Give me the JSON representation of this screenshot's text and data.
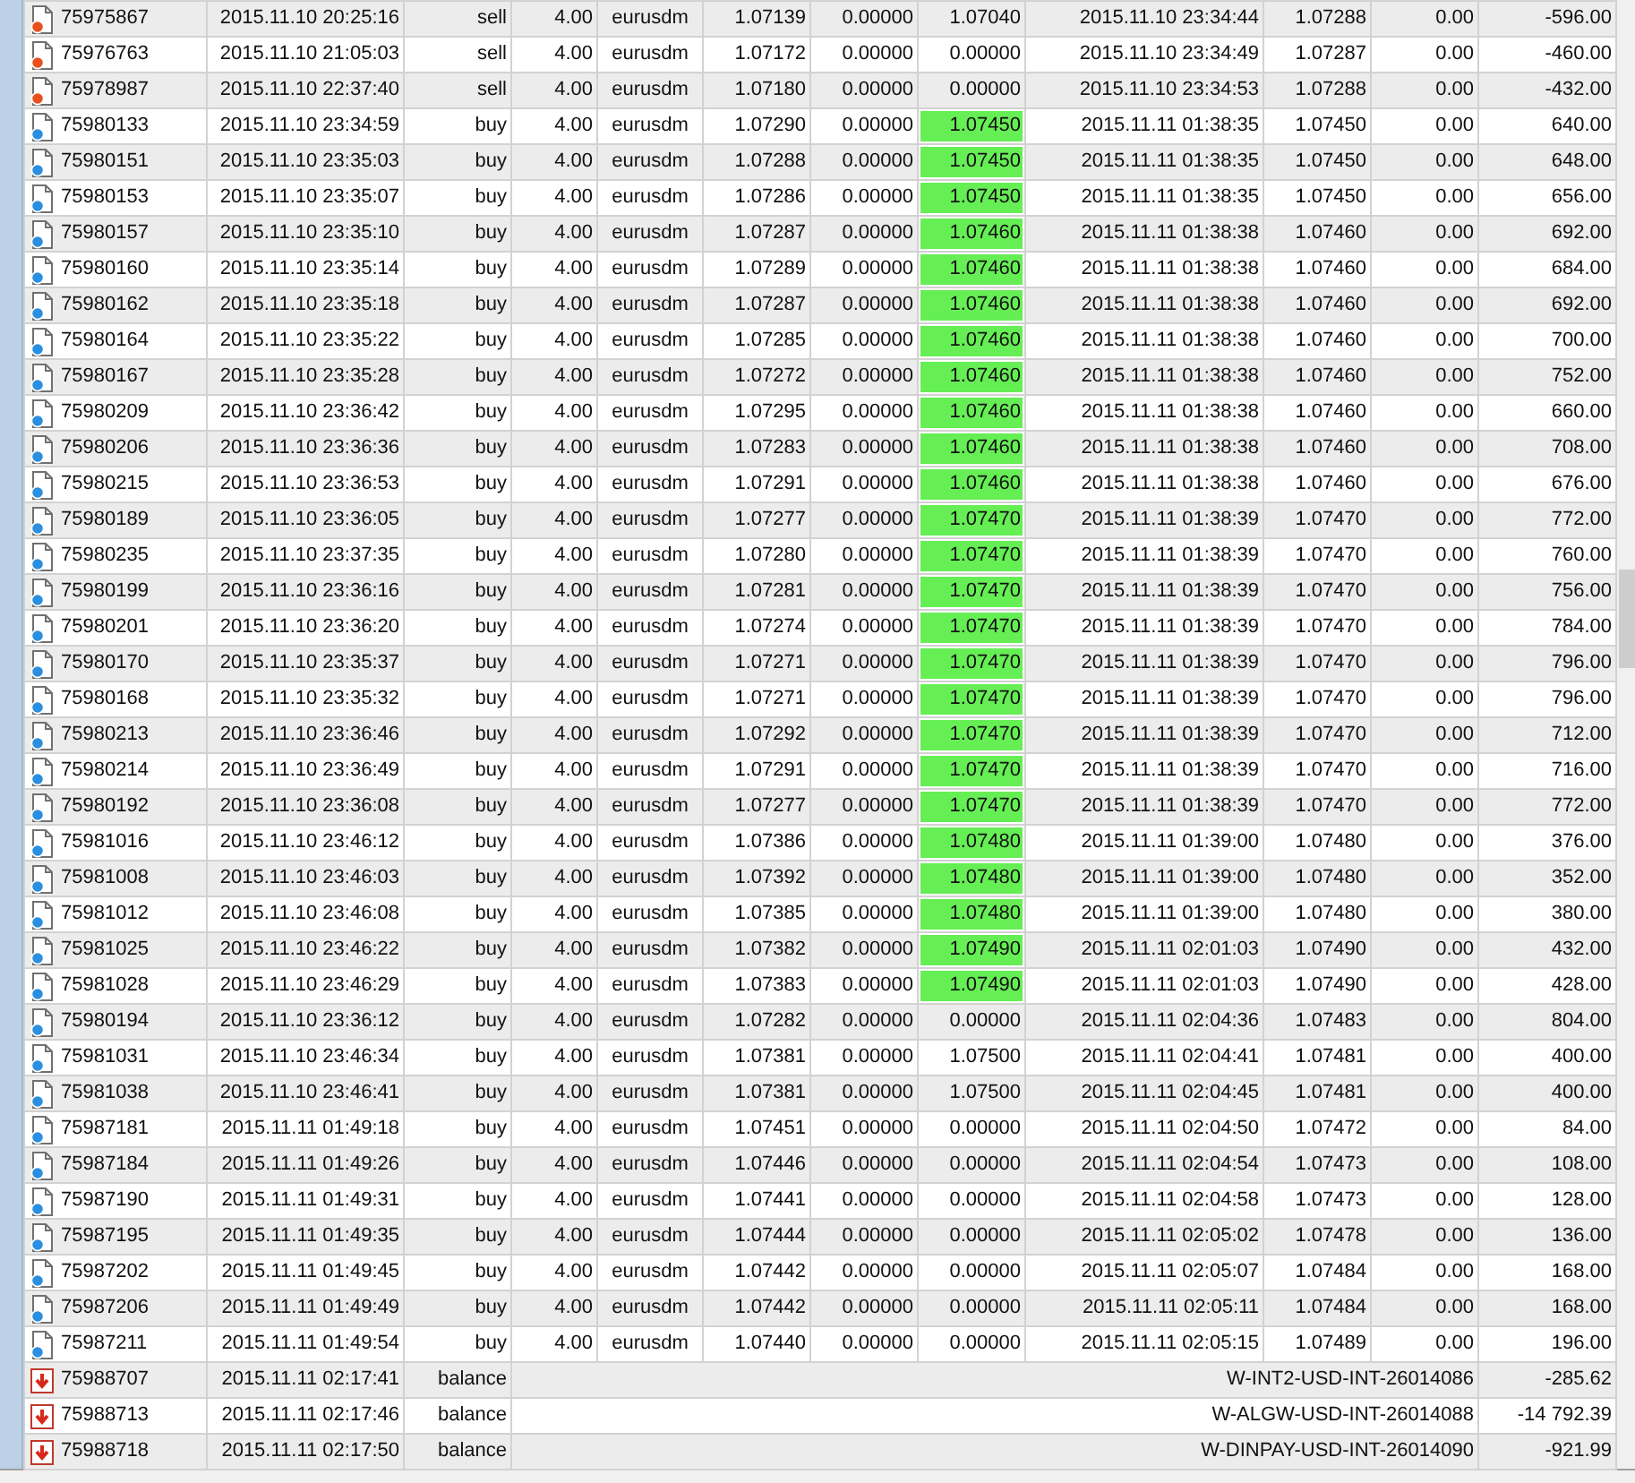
{
  "history": {
    "rows": [
      {
        "kind": "sell",
        "ticket": "75975867",
        "time": "2015.11.10 20:25:16",
        "type": "sell",
        "size": "4.00",
        "symbol": "eurusdm",
        "price": "1.07139",
        "sl": "0.00000",
        "tp": "1.07040",
        "tp_highlighted": false,
        "close_time": "2015.11.10 23:34:44",
        "close_price": "1.07288",
        "column_11": "0.00",
        "profit": "-596.00"
      },
      {
        "kind": "sell",
        "ticket": "75976763",
        "time": "2015.11.10 21:05:03",
        "type": "sell",
        "size": "4.00",
        "symbol": "eurusdm",
        "price": "1.07172",
        "sl": "0.00000",
        "tp": "0.00000",
        "tp_highlighted": false,
        "close_time": "2015.11.10 23:34:49",
        "close_price": "1.07287",
        "column_11": "0.00",
        "profit": "-460.00"
      },
      {
        "kind": "sell",
        "ticket": "75978987",
        "time": "2015.11.10 22:37:40",
        "type": "sell",
        "size": "4.00",
        "symbol": "eurusdm",
        "price": "1.07180",
        "sl": "0.00000",
        "tp": "0.00000",
        "tp_highlighted": false,
        "close_time": "2015.11.10 23:34:53",
        "close_price": "1.07288",
        "column_11": "0.00",
        "profit": "-432.00"
      },
      {
        "kind": "buy",
        "ticket": "75980133",
        "time": "2015.11.10 23:34:59",
        "type": "buy",
        "size": "4.00",
        "symbol": "eurusdm",
        "price": "1.07290",
        "sl": "0.00000",
        "tp": "1.07450",
        "tp_highlighted": true,
        "close_time": "2015.11.11 01:38:35",
        "close_price": "1.07450",
        "column_11": "0.00",
        "profit": "640.00"
      },
      {
        "kind": "buy",
        "ticket": "75980151",
        "time": "2015.11.10 23:35:03",
        "type": "buy",
        "size": "4.00",
        "symbol": "eurusdm",
        "price": "1.07288",
        "sl": "0.00000",
        "tp": "1.07450",
        "tp_highlighted": true,
        "close_time": "2015.11.11 01:38:35",
        "close_price": "1.07450",
        "column_11": "0.00",
        "profit": "648.00"
      },
      {
        "kind": "buy",
        "ticket": "75980153",
        "time": "2015.11.10 23:35:07",
        "type": "buy",
        "size": "4.00",
        "symbol": "eurusdm",
        "price": "1.07286",
        "sl": "0.00000",
        "tp": "1.07450",
        "tp_highlighted": true,
        "close_time": "2015.11.11 01:38:35",
        "close_price": "1.07450",
        "column_11": "0.00",
        "profit": "656.00"
      },
      {
        "kind": "buy",
        "ticket": "75980157",
        "time": "2015.11.10 23:35:10",
        "type": "buy",
        "size": "4.00",
        "symbol": "eurusdm",
        "price": "1.07287",
        "sl": "0.00000",
        "tp": "1.07460",
        "tp_highlighted": true,
        "close_time": "2015.11.11 01:38:38",
        "close_price": "1.07460",
        "column_11": "0.00",
        "profit": "692.00"
      },
      {
        "kind": "buy",
        "ticket": "75980160",
        "time": "2015.11.10 23:35:14",
        "type": "buy",
        "size": "4.00",
        "symbol": "eurusdm",
        "price": "1.07289",
        "sl": "0.00000",
        "tp": "1.07460",
        "tp_highlighted": true,
        "close_time": "2015.11.11 01:38:38",
        "close_price": "1.07460",
        "column_11": "0.00",
        "profit": "684.00"
      },
      {
        "kind": "buy",
        "ticket": "75980162",
        "time": "2015.11.10 23:35:18",
        "type": "buy",
        "size": "4.00",
        "symbol": "eurusdm",
        "price": "1.07287",
        "sl": "0.00000",
        "tp": "1.07460",
        "tp_highlighted": true,
        "close_time": "2015.11.11 01:38:38",
        "close_price": "1.07460",
        "column_11": "0.00",
        "profit": "692.00"
      },
      {
        "kind": "buy",
        "ticket": "75980164",
        "time": "2015.11.10 23:35:22",
        "type": "buy",
        "size": "4.00",
        "symbol": "eurusdm",
        "price": "1.07285",
        "sl": "0.00000",
        "tp": "1.07460",
        "tp_highlighted": true,
        "close_time": "2015.11.11 01:38:38",
        "close_price": "1.07460",
        "column_11": "0.00",
        "profit": "700.00"
      },
      {
        "kind": "buy",
        "ticket": "75980167",
        "time": "2015.11.10 23:35:28",
        "type": "buy",
        "size": "4.00",
        "symbol": "eurusdm",
        "price": "1.07272",
        "sl": "0.00000",
        "tp": "1.07460",
        "tp_highlighted": true,
        "close_time": "2015.11.11 01:38:38",
        "close_price": "1.07460",
        "column_11": "0.00",
        "profit": "752.00"
      },
      {
        "kind": "buy",
        "ticket": "75980209",
        "time": "2015.11.10 23:36:42",
        "type": "buy",
        "size": "4.00",
        "symbol": "eurusdm",
        "price": "1.07295",
        "sl": "0.00000",
        "tp": "1.07460",
        "tp_highlighted": true,
        "close_time": "2015.11.11 01:38:38",
        "close_price": "1.07460",
        "column_11": "0.00",
        "profit": "660.00"
      },
      {
        "kind": "buy",
        "ticket": "75980206",
        "time": "2015.11.10 23:36:36",
        "type": "buy",
        "size": "4.00",
        "symbol": "eurusdm",
        "price": "1.07283",
        "sl": "0.00000",
        "tp": "1.07460",
        "tp_highlighted": true,
        "close_time": "2015.11.11 01:38:38",
        "close_price": "1.07460",
        "column_11": "0.00",
        "profit": "708.00"
      },
      {
        "kind": "buy",
        "ticket": "75980215",
        "time": "2015.11.10 23:36:53",
        "type": "buy",
        "size": "4.00",
        "symbol": "eurusdm",
        "price": "1.07291",
        "sl": "0.00000",
        "tp": "1.07460",
        "tp_highlighted": true,
        "close_time": "2015.11.11 01:38:38",
        "close_price": "1.07460",
        "column_11": "0.00",
        "profit": "676.00"
      },
      {
        "kind": "buy",
        "ticket": "75980189",
        "time": "2015.11.10 23:36:05",
        "type": "buy",
        "size": "4.00",
        "symbol": "eurusdm",
        "price": "1.07277",
        "sl": "0.00000",
        "tp": "1.07470",
        "tp_highlighted": true,
        "close_time": "2015.11.11 01:38:39",
        "close_price": "1.07470",
        "column_11": "0.00",
        "profit": "772.00"
      },
      {
        "kind": "buy",
        "ticket": "75980235",
        "time": "2015.11.10 23:37:35",
        "type": "buy",
        "size": "4.00",
        "symbol": "eurusdm",
        "price": "1.07280",
        "sl": "0.00000",
        "tp": "1.07470",
        "tp_highlighted": true,
        "close_time": "2015.11.11 01:38:39",
        "close_price": "1.07470",
        "column_11": "0.00",
        "profit": "760.00"
      },
      {
        "kind": "buy",
        "ticket": "75980199",
        "time": "2015.11.10 23:36:16",
        "type": "buy",
        "size": "4.00",
        "symbol": "eurusdm",
        "price": "1.07281",
        "sl": "0.00000",
        "tp": "1.07470",
        "tp_highlighted": true,
        "close_time": "2015.11.11 01:38:39",
        "close_price": "1.07470",
        "column_11": "0.00",
        "profit": "756.00"
      },
      {
        "kind": "buy",
        "ticket": "75980201",
        "time": "2015.11.10 23:36:20",
        "type": "buy",
        "size": "4.00",
        "symbol": "eurusdm",
        "price": "1.07274",
        "sl": "0.00000",
        "tp": "1.07470",
        "tp_highlighted": true,
        "close_time": "2015.11.11 01:38:39",
        "close_price": "1.07470",
        "column_11": "0.00",
        "profit": "784.00"
      },
      {
        "kind": "buy",
        "ticket": "75980170",
        "time": "2015.11.10 23:35:37",
        "type": "buy",
        "size": "4.00",
        "symbol": "eurusdm",
        "price": "1.07271",
        "sl": "0.00000",
        "tp": "1.07470",
        "tp_highlighted": true,
        "close_time": "2015.11.11 01:38:39",
        "close_price": "1.07470",
        "column_11": "0.00",
        "profit": "796.00"
      },
      {
        "kind": "buy",
        "ticket": "75980168",
        "time": "2015.11.10 23:35:32",
        "type": "buy",
        "size": "4.00",
        "symbol": "eurusdm",
        "price": "1.07271",
        "sl": "0.00000",
        "tp": "1.07470",
        "tp_highlighted": true,
        "close_time": "2015.11.11 01:38:39",
        "close_price": "1.07470",
        "column_11": "0.00",
        "profit": "796.00"
      },
      {
        "kind": "buy",
        "ticket": "75980213",
        "time": "2015.11.10 23:36:46",
        "type": "buy",
        "size": "4.00",
        "symbol": "eurusdm",
        "price": "1.07292",
        "sl": "0.00000",
        "tp": "1.07470",
        "tp_highlighted": true,
        "close_time": "2015.11.11 01:38:39",
        "close_price": "1.07470",
        "column_11": "0.00",
        "profit": "712.00"
      },
      {
        "kind": "buy",
        "ticket": "75980214",
        "time": "2015.11.10 23:36:49",
        "type": "buy",
        "size": "4.00",
        "symbol": "eurusdm",
        "price": "1.07291",
        "sl": "0.00000",
        "tp": "1.07470",
        "tp_highlighted": true,
        "close_time": "2015.11.11 01:38:39",
        "close_price": "1.07470",
        "column_11": "0.00",
        "profit": "716.00"
      },
      {
        "kind": "buy",
        "ticket": "75980192",
        "time": "2015.11.10 23:36:08",
        "type": "buy",
        "size": "4.00",
        "symbol": "eurusdm",
        "price": "1.07277",
        "sl": "0.00000",
        "tp": "1.07470",
        "tp_highlighted": true,
        "close_time": "2015.11.11 01:38:39",
        "close_price": "1.07470",
        "column_11": "0.00",
        "profit": "772.00"
      },
      {
        "kind": "buy",
        "ticket": "75981016",
        "time": "2015.11.10 23:46:12",
        "type": "buy",
        "size": "4.00",
        "symbol": "eurusdm",
        "price": "1.07386",
        "sl": "0.00000",
        "tp": "1.07480",
        "tp_highlighted": true,
        "close_time": "2015.11.11 01:39:00",
        "close_price": "1.07480",
        "column_11": "0.00",
        "profit": "376.00"
      },
      {
        "kind": "buy",
        "ticket": "75981008",
        "time": "2015.11.10 23:46:03",
        "type": "buy",
        "size": "4.00",
        "symbol": "eurusdm",
        "price": "1.07392",
        "sl": "0.00000",
        "tp": "1.07480",
        "tp_highlighted": true,
        "close_time": "2015.11.11 01:39:00",
        "close_price": "1.07480",
        "column_11": "0.00",
        "profit": "352.00"
      },
      {
        "kind": "buy",
        "ticket": "75981012",
        "time": "2015.11.10 23:46:08",
        "type": "buy",
        "size": "4.00",
        "symbol": "eurusdm",
        "price": "1.07385",
        "sl": "0.00000",
        "tp": "1.07480",
        "tp_highlighted": true,
        "close_time": "2015.11.11 01:39:00",
        "close_price": "1.07480",
        "column_11": "0.00",
        "profit": "380.00"
      },
      {
        "kind": "buy",
        "ticket": "75981025",
        "time": "2015.11.10 23:46:22",
        "type": "buy",
        "size": "4.00",
        "symbol": "eurusdm",
        "price": "1.07382",
        "sl": "0.00000",
        "tp": "1.07490",
        "tp_highlighted": true,
        "close_time": "2015.11.11 02:01:03",
        "close_price": "1.07490",
        "column_11": "0.00",
        "profit": "432.00"
      },
      {
        "kind": "buy",
        "ticket": "75981028",
        "time": "2015.11.10 23:46:29",
        "type": "buy",
        "size": "4.00",
        "symbol": "eurusdm",
        "price": "1.07383",
        "sl": "0.00000",
        "tp": "1.07490",
        "tp_highlighted": true,
        "close_time": "2015.11.11 02:01:03",
        "close_price": "1.07490",
        "column_11": "0.00",
        "profit": "428.00"
      },
      {
        "kind": "buy",
        "ticket": "75980194",
        "time": "2015.11.10 23:36:12",
        "type": "buy",
        "size": "4.00",
        "symbol": "eurusdm",
        "price": "1.07282",
        "sl": "0.00000",
        "tp": "0.00000",
        "tp_highlighted": false,
        "close_time": "2015.11.11 02:04:36",
        "close_price": "1.07483",
        "column_11": "0.00",
        "profit": "804.00"
      },
      {
        "kind": "buy",
        "ticket": "75981031",
        "time": "2015.11.10 23:46:34",
        "type": "buy",
        "size": "4.00",
        "symbol": "eurusdm",
        "price": "1.07381",
        "sl": "0.00000",
        "tp": "1.07500",
        "tp_highlighted": false,
        "close_time": "2015.11.11 02:04:41",
        "close_price": "1.07481",
        "column_11": "0.00",
        "profit": "400.00"
      },
      {
        "kind": "buy",
        "ticket": "75981038",
        "time": "2015.11.10 23:46:41",
        "type": "buy",
        "size": "4.00",
        "symbol": "eurusdm",
        "price": "1.07381",
        "sl": "0.00000",
        "tp": "1.07500",
        "tp_highlighted": false,
        "close_time": "2015.11.11 02:04:45",
        "close_price": "1.07481",
        "column_11": "0.00",
        "profit": "400.00"
      },
      {
        "kind": "buy",
        "ticket": "75987181",
        "time": "2015.11.11 01:49:18",
        "type": "buy",
        "size": "4.00",
        "symbol": "eurusdm",
        "price": "1.07451",
        "sl": "0.00000",
        "tp": "0.00000",
        "tp_highlighted": false,
        "close_time": "2015.11.11 02:04:50",
        "close_price": "1.07472",
        "column_11": "0.00",
        "profit": "84.00"
      },
      {
        "kind": "buy",
        "ticket": "75987184",
        "time": "2015.11.11 01:49:26",
        "type": "buy",
        "size": "4.00",
        "symbol": "eurusdm",
        "price": "1.07446",
        "sl": "0.00000",
        "tp": "0.00000",
        "tp_highlighted": false,
        "close_time": "2015.11.11 02:04:54",
        "close_price": "1.07473",
        "column_11": "0.00",
        "profit": "108.00"
      },
      {
        "kind": "buy",
        "ticket": "75987190",
        "time": "2015.11.11 01:49:31",
        "type": "buy",
        "size": "4.00",
        "symbol": "eurusdm",
        "price": "1.07441",
        "sl": "0.00000",
        "tp": "0.00000",
        "tp_highlighted": false,
        "close_time": "2015.11.11 02:04:58",
        "close_price": "1.07473",
        "column_11": "0.00",
        "profit": "128.00"
      },
      {
        "kind": "buy",
        "ticket": "75987195",
        "time": "2015.11.11 01:49:35",
        "type": "buy",
        "size": "4.00",
        "symbol": "eurusdm",
        "price": "1.07444",
        "sl": "0.00000",
        "tp": "0.00000",
        "tp_highlighted": false,
        "close_time": "2015.11.11 02:05:02",
        "close_price": "1.07478",
        "column_11": "0.00",
        "profit": "136.00"
      },
      {
        "kind": "buy",
        "ticket": "75987202",
        "time": "2015.11.11 01:49:45",
        "type": "buy",
        "size": "4.00",
        "symbol": "eurusdm",
        "price": "1.07442",
        "sl": "0.00000",
        "tp": "0.00000",
        "tp_highlighted": false,
        "close_time": "2015.11.11 02:05:07",
        "close_price": "1.07484",
        "column_11": "0.00",
        "profit": "168.00"
      },
      {
        "kind": "buy",
        "ticket": "75987206",
        "time": "2015.11.11 01:49:49",
        "type": "buy",
        "size": "4.00",
        "symbol": "eurusdm",
        "price": "1.07442",
        "sl": "0.00000",
        "tp": "0.00000",
        "tp_highlighted": false,
        "close_time": "2015.11.11 02:05:11",
        "close_price": "1.07484",
        "column_11": "0.00",
        "profit": "168.00"
      },
      {
        "kind": "buy",
        "ticket": "75987211",
        "time": "2015.11.11 01:49:54",
        "type": "buy",
        "size": "4.00",
        "symbol": "eurusdm",
        "price": "1.07440",
        "sl": "0.00000",
        "tp": "0.00000",
        "tp_highlighted": false,
        "close_time": "2015.11.11 02:05:15",
        "close_price": "1.07489",
        "column_11": "0.00",
        "profit": "196.00"
      },
      {
        "kind": "balance",
        "ticket": "75988707",
        "time": "2015.11.11 02:17:41",
        "type": "balance",
        "comment": "W-INT2-USD-INT-26014086",
        "profit": "-285.62"
      },
      {
        "kind": "balance",
        "ticket": "75988713",
        "time": "2015.11.11 02:17:46",
        "type": "balance",
        "comment": "W-ALGW-USD-INT-26014088",
        "profit": "-14 792.39"
      },
      {
        "kind": "balance",
        "ticket": "75988718",
        "time": "2015.11.11 02:17:50",
        "type": "balance",
        "comment": "W-DINPAY-USD-INT-26014090",
        "profit": "-921.99"
      }
    ]
  }
}
